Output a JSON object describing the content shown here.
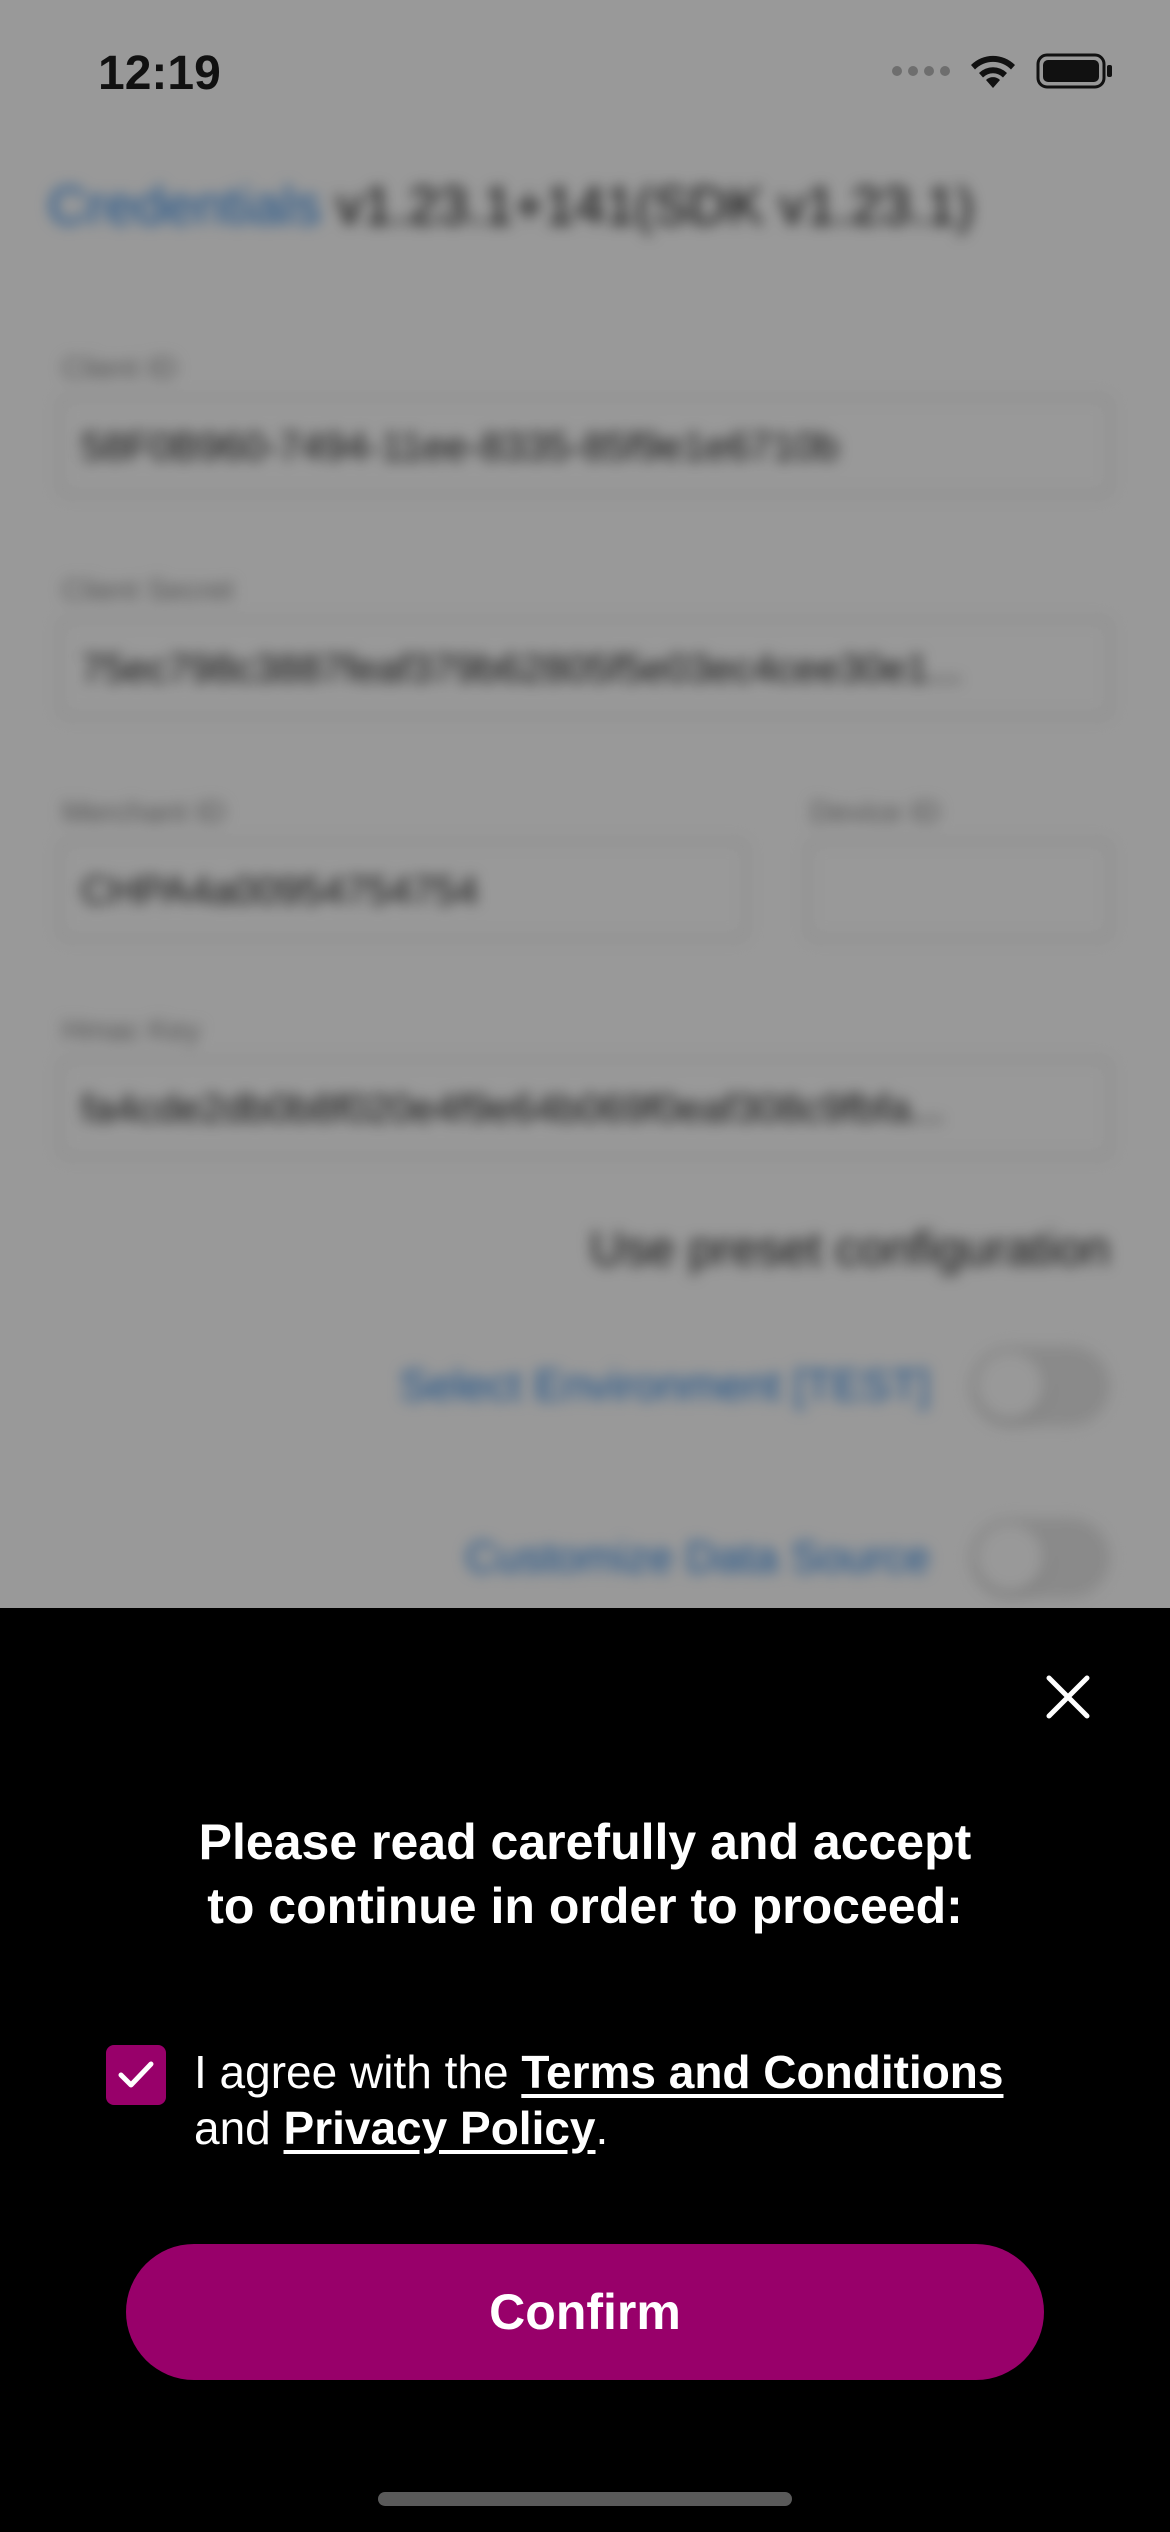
{
  "status_bar": {
    "time": "12:19"
  },
  "background_screen": {
    "header_link": "Credentials",
    "header_version": "v1.23.1+141(SDK v1.23.1)",
    "fields": {
      "client_id": {
        "label": "Client ID",
        "value": "58F0B960-7494-11ee-8335-85f9e1e6710b"
      },
      "client_secret": {
        "label": "Client Secret",
        "value": "75ec798c3887feaf379b62805f5e03ec4cee30e1..."
      },
      "merchant_id": {
        "label": "Merchant ID",
        "value": "CHPA4a00954754754"
      },
      "device_id": {
        "label": "Device ID",
        "value": ""
      },
      "hmac_key": {
        "label": "Hmac Key",
        "value": "fa4cde2db0b8f020e4f9e64b069f0eaf308c9fbfa..."
      }
    },
    "preset_label": "Use preset configuration",
    "select_environment": {
      "label": "Select Environment [TEST]",
      "on": false
    },
    "customize_data_source": {
      "label": "Customize Data Source",
      "on": false
    }
  },
  "consent_sheet": {
    "title_line1": "Please read carefully and accept",
    "title_line2": "to continue in order to proceed:",
    "checkbox_checked": true,
    "agree_prefix": "I agree with the ",
    "terms_link": "Terms and Conditions",
    "agree_middle": "and ",
    "privacy_link": "Privacy Policy",
    "agree_suffix": ".",
    "confirm_label": "Confirm"
  },
  "colors": {
    "accent": "#98006a",
    "sheet_background": "#000000",
    "link_blue": "#2b86e6"
  },
  "icons": {
    "close": "close-icon",
    "check": "checkmark-icon",
    "wifi": "wifi-icon",
    "battery": "battery-icon",
    "signal": "signal-dots-icon"
  }
}
